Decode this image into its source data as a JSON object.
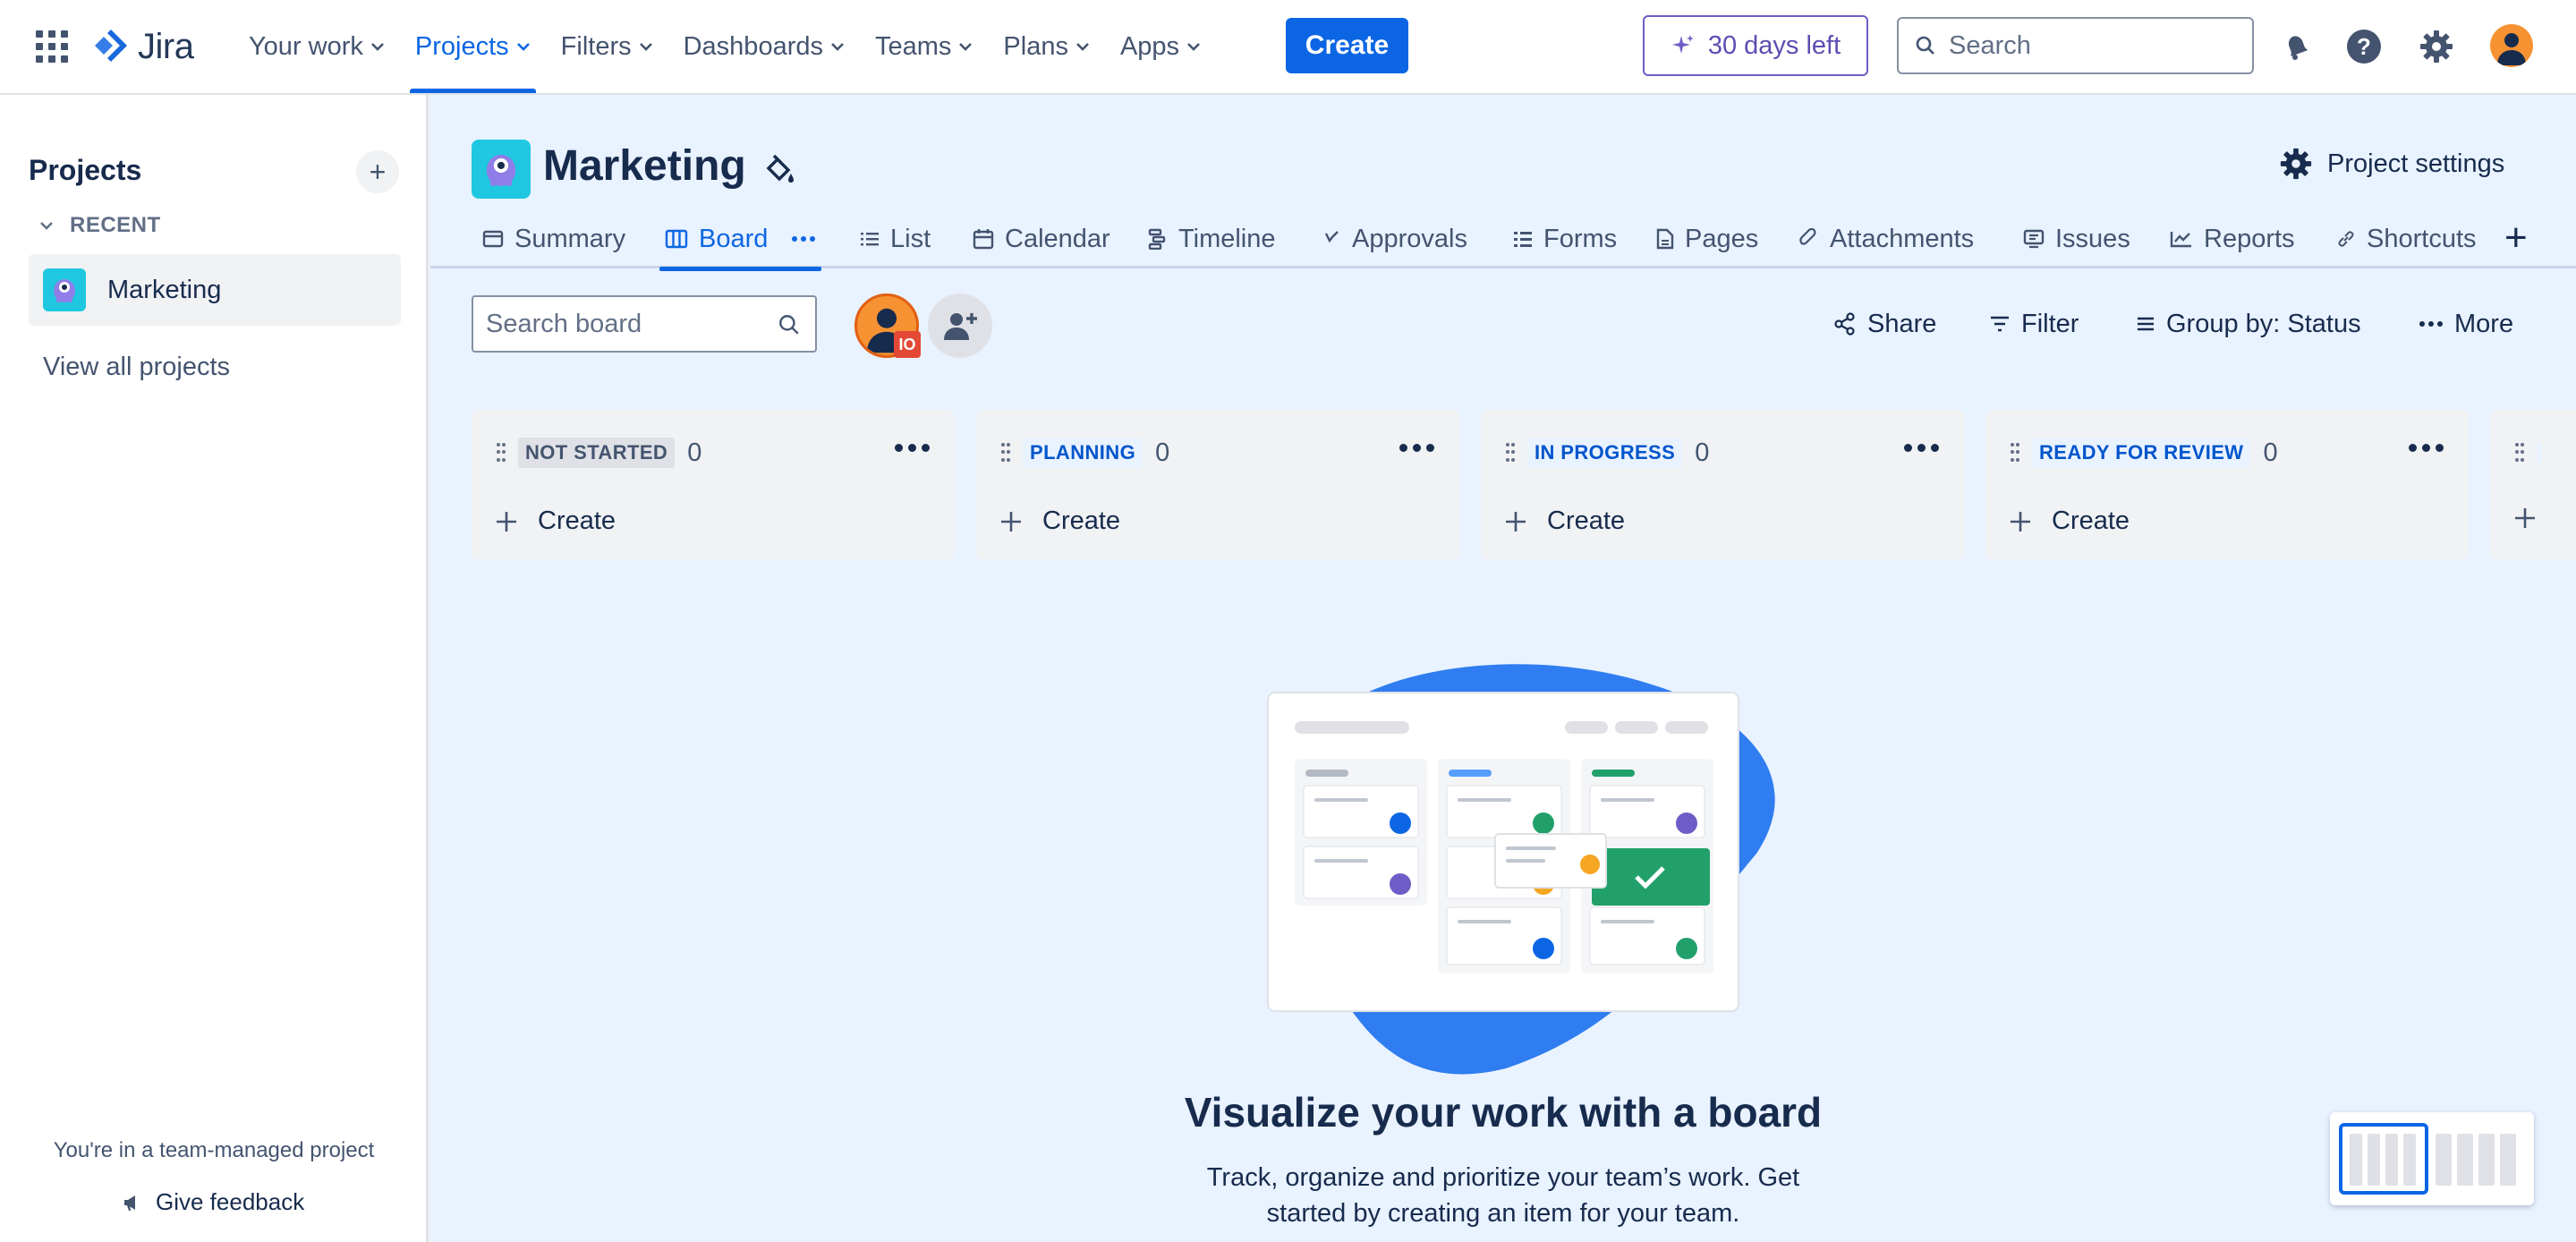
{
  "nav": {
    "logo_text": "Jira",
    "items": [
      {
        "label": "Your work"
      },
      {
        "label": "Projects"
      },
      {
        "label": "Filters"
      },
      {
        "label": "Dashboards"
      },
      {
        "label": "Teams"
      },
      {
        "label": "Plans"
      },
      {
        "label": "Apps"
      }
    ],
    "active_item": "Projects",
    "create_label": "Create",
    "trial_label": "30 days left",
    "search_placeholder": "Search"
  },
  "sidebar": {
    "title": "Projects",
    "recent_label": "RECENT",
    "recent_projects": [
      {
        "label": "Marketing"
      }
    ],
    "view_all_label": "View all projects",
    "footer_note": "You're in a team-managed project",
    "feedback_label": "Give feedback"
  },
  "project": {
    "title": "Marketing",
    "settings_label": "Project settings"
  },
  "tabs": [
    {
      "label": "Summary",
      "icon": "summary-icon"
    },
    {
      "label": "Board",
      "icon": "board-icon",
      "active": true
    },
    {
      "label": "List",
      "icon": "list-icon"
    },
    {
      "label": "Calendar",
      "icon": "calendar-icon"
    },
    {
      "label": "Timeline",
      "icon": "timeline-icon"
    },
    {
      "label": "Approvals",
      "icon": "approvals-icon"
    },
    {
      "label": "Forms",
      "icon": "forms-icon"
    },
    {
      "label": "Pages",
      "icon": "pages-icon"
    },
    {
      "label": "Attachments",
      "icon": "attachment-icon"
    },
    {
      "label": "Issues",
      "icon": "issues-icon"
    },
    {
      "label": "Reports",
      "icon": "reports-icon"
    },
    {
      "label": "Shortcuts",
      "icon": "link-icon"
    }
  ],
  "board": {
    "search_placeholder": "Search board",
    "avatar_badge": "IO",
    "toolbar": {
      "share": "Share",
      "filter": "Filter",
      "group_by": "Group by: Status",
      "more": "More"
    },
    "columns": [
      {
        "status": "NOT STARTED",
        "count": "0",
        "create": "Create",
        "lozenge_bg": "#dfe1e6",
        "lozenge_fg": "#44546f"
      },
      {
        "status": "PLANNING",
        "count": "0",
        "create": "Create",
        "lozenge_bg": "#e9f2ff",
        "lozenge_fg": "#0055cc"
      },
      {
        "status": "IN PROGRESS",
        "count": "0",
        "create": "Create",
        "lozenge_bg": "#e9f2ff",
        "lozenge_fg": "#0055cc"
      },
      {
        "status": "READY FOR REVIEW",
        "count": "0",
        "create": "Create",
        "lozenge_bg": "#e9f2ff",
        "lozenge_fg": "#0055cc"
      }
    ]
  },
  "empty_state": {
    "title": "Visualize your work with a board",
    "line1": "Track, organize and prioritize your team’s work. Get",
    "line2": "started by creating an item for your team."
  },
  "colors": {
    "brand_blue": "#0c66e4",
    "main_bg": "#e9f2ff",
    "trial_purple": "#6e5dc6"
  }
}
